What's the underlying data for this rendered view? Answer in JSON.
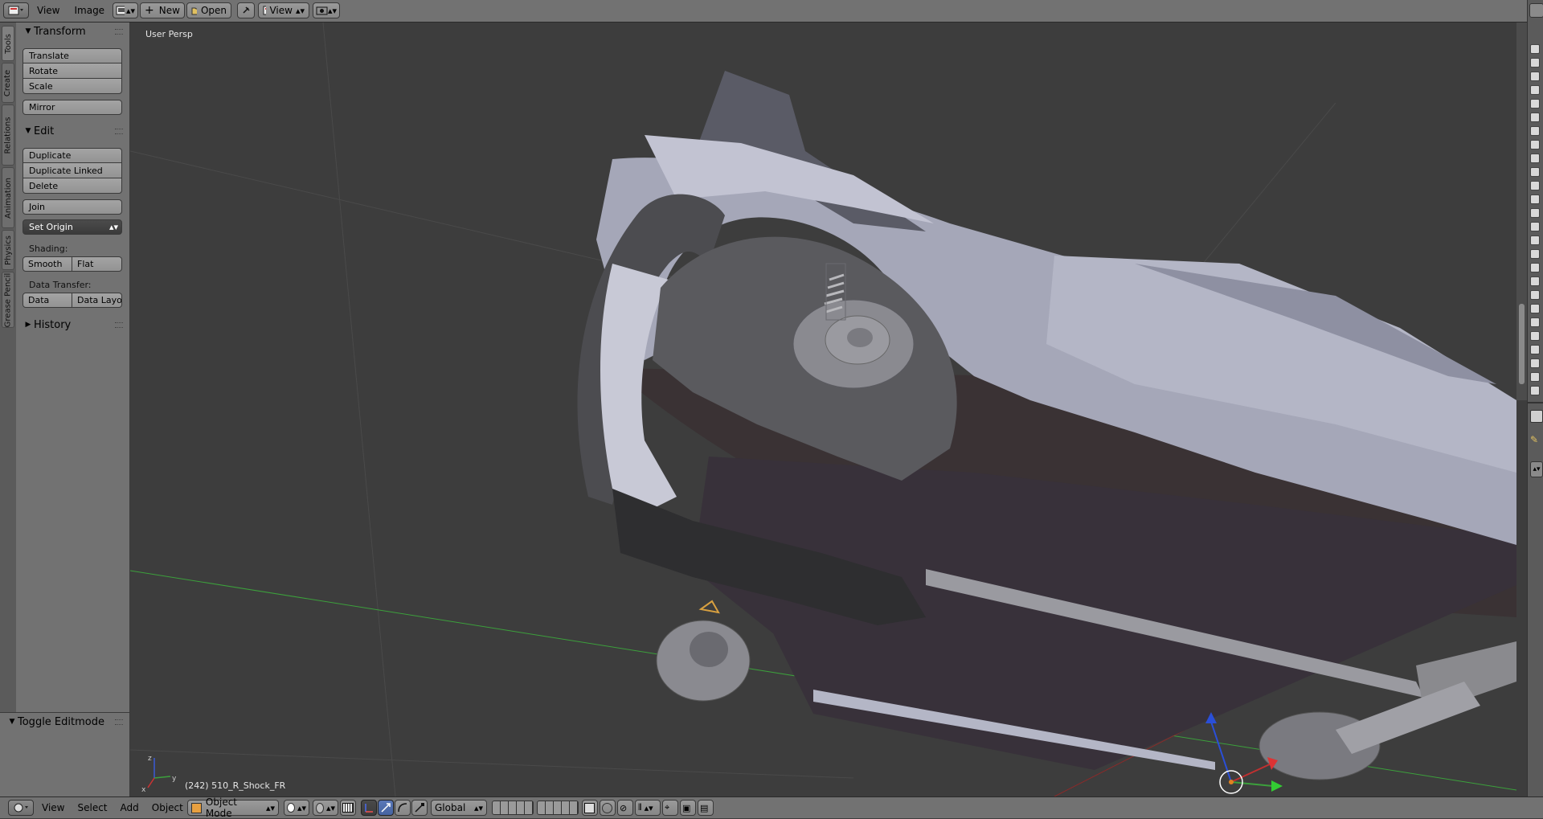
{
  "header": {
    "menus": [
      "View",
      "Image"
    ],
    "new_label": "New",
    "open_label": "Open",
    "view_label": "View"
  },
  "viewport": {
    "perspective_label": "User Persp",
    "object_info": "(242) 510_R_Shock_FR"
  },
  "tool_tabs": [
    "Tools",
    "Create",
    "Relations",
    "Animation",
    "Physics",
    "Grease Pencil"
  ],
  "tool_shelf": {
    "transform": {
      "title": "Transform",
      "buttons": [
        "Translate",
        "Rotate",
        "Scale"
      ],
      "mirror": "Mirror"
    },
    "edit": {
      "title": "Edit",
      "buttons": [
        "Duplicate",
        "Duplicate Linked",
        "Delete"
      ],
      "join": "Join",
      "set_origin": "Set Origin",
      "shading_label": "Shading:",
      "smooth": "Smooth",
      "flat": "Flat",
      "data_transfer_label": "Data Transfer:",
      "data": "Data",
      "data_layout": "Data Layo"
    },
    "history": {
      "title": "History"
    },
    "operator": {
      "title": "Toggle Editmode"
    }
  },
  "footer": {
    "menus": [
      "View",
      "Select",
      "Add",
      "Object"
    ],
    "mode": "Object Mode",
    "orientation": "Global"
  },
  "colors": {
    "viewport_bg": "#3d3d3d",
    "header_bg": "#727272",
    "x_axis": "#b43c3c",
    "y_axis": "#3ca03c",
    "z_axis": "#2a4fd8",
    "model_body": "#a5a7b8",
    "model_dark": "#4a4a4c"
  },
  "icons": [
    "editor-type-icon",
    "pin-icon",
    "camera-icon",
    "sphere-shading-icon",
    "manipulator-icon",
    "layer-grid-icon",
    "render-icon"
  ]
}
